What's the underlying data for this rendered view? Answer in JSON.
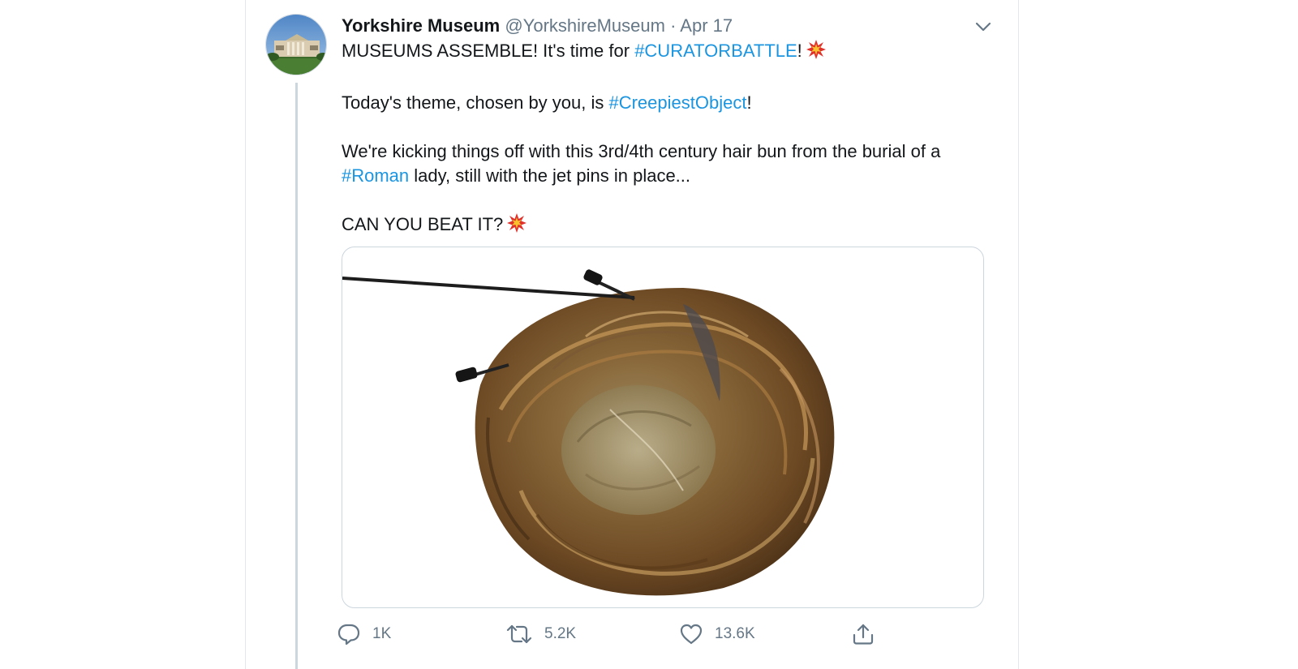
{
  "tweet": {
    "author": {
      "display_name": "Yorkshire Museum",
      "handle": "@YorkshireMuseum",
      "separator": "·",
      "date": "Apr 17",
      "avatar": "museum-building-photo"
    },
    "text": {
      "p1_pre": "MUSEUMS ASSEMBLE! It's time for ",
      "p1_tag": "#CURATORBATTLE",
      "p1_post": "!",
      "p2_pre": "Today's theme, chosen by you, is ",
      "p2_tag": "#CreepiestObject",
      "p2_post": "!",
      "p3_pre": "We're kicking things off with this 3rd/4th century hair bun from the burial of a ",
      "p3_tag": "#Roman",
      "p3_post": " lady, still with the jet pins in place...",
      "p4": "CAN YOU BEAT IT?"
    },
    "emoji": "collision-emoji",
    "media": {
      "subject": "roman-hair-bun-with-jet-pins"
    },
    "actions": {
      "reply_count": "1K",
      "retweet_count": "5.2K",
      "like_count": "13.6K"
    },
    "icons": [
      "reply-icon",
      "retweet-icon",
      "like-icon",
      "share-icon",
      "chevron-down-icon"
    ],
    "colors": {
      "link": "#1b95e0",
      "secondary_text": "#657786",
      "thread_line": "#ccd6dd"
    }
  }
}
